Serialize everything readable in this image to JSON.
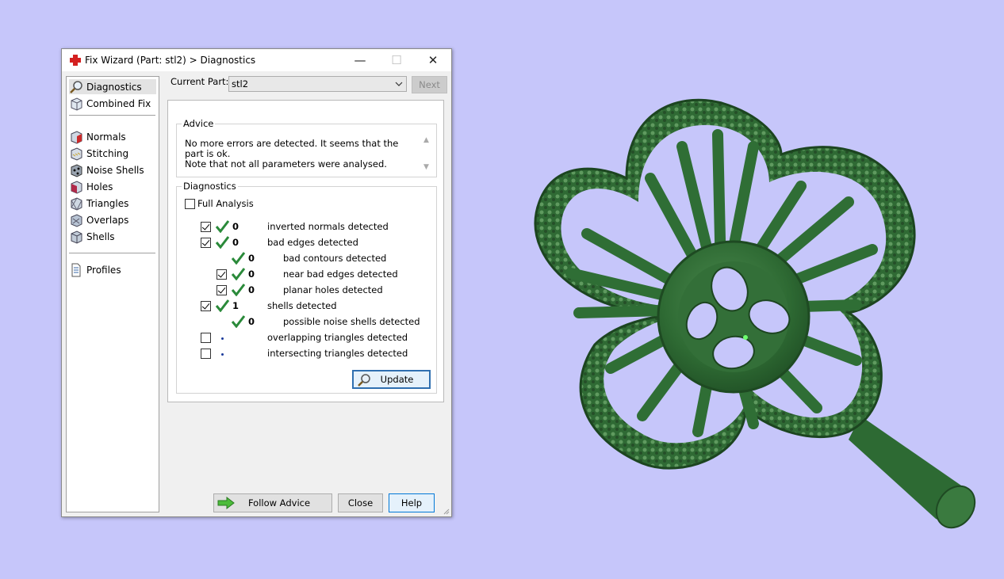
{
  "window": {
    "title": "Fix Wizard (Part: stl2) > Diagnostics",
    "controls": {
      "minimize": "—",
      "maximize": "☐",
      "close": "✕"
    }
  },
  "nav": {
    "items": [
      {
        "label": "Diagnostics",
        "icon": "magnifier-icon",
        "selected": true
      },
      {
        "label": "Combined Fix",
        "icon": "cube-icon"
      },
      {
        "label": "Normals",
        "icon": "normals-cube-icon"
      },
      {
        "label": "Stitching",
        "icon": "stitching-cube-icon"
      },
      {
        "label": "Noise Shells",
        "icon": "noise-shells-icon"
      },
      {
        "label": "Holes",
        "icon": "holes-cube-icon"
      },
      {
        "label": "Triangles",
        "icon": "triangles-cube-icon"
      },
      {
        "label": "Overlaps",
        "icon": "overlaps-cube-icon"
      },
      {
        "label": "Shells",
        "icon": "shells-cube-icon"
      },
      {
        "label": "Profiles",
        "icon": "document-icon"
      }
    ]
  },
  "current_part": {
    "label": "Current Part:",
    "value": "stl2"
  },
  "next_label": "Next",
  "advice": {
    "title": "Advice",
    "text_line1": "No more errors are detected. It seems that the part is ok.",
    "text_line2": "Note that not all parameters were analysed."
  },
  "diagnostics": {
    "title": "Diagnostics",
    "full_analysis": {
      "label": "Full Analysis",
      "checked": false
    },
    "rows": [
      {
        "checkbox": "checked",
        "status": "ok",
        "count": "0",
        "label": "inverted normals detected"
      },
      {
        "checkbox": "checked",
        "status": "ok",
        "count": "0",
        "label": "bad edges detected"
      },
      {
        "checkbox": "none",
        "status": "ok",
        "count": "0",
        "label": "bad contours detected"
      },
      {
        "checkbox": "checked",
        "status": "ok",
        "count": "0",
        "label": "near bad edges detected"
      },
      {
        "checkbox": "checked",
        "status": "ok",
        "count": "0",
        "label": "planar holes detected"
      },
      {
        "checkbox": "checked",
        "status": "ok",
        "count": "1",
        "label": "shells detected"
      },
      {
        "checkbox": "none",
        "status": "ok",
        "count": "0",
        "label": "possible noise shells detected"
      },
      {
        "checkbox": "unchecked",
        "status": "not-analysed",
        "count": "",
        "label": "overlapping triangles detected"
      },
      {
        "checkbox": "unchecked",
        "status": "not-analysed",
        "count": "",
        "label": "intersecting triangles detected"
      }
    ],
    "update_label": "Update"
  },
  "footer": {
    "follow_advice_label": "Follow Advice",
    "close_label": "Close",
    "help_label": "Help"
  },
  "colors": {
    "background": "#c6c6fa",
    "model_green": "#2f6b34",
    "tick_green": "#2a8a3a",
    "app_icon_red": "#d42020"
  },
  "model": {
    "type": "clover-shaped 3D part render",
    "icon": "shamrock-model"
  }
}
